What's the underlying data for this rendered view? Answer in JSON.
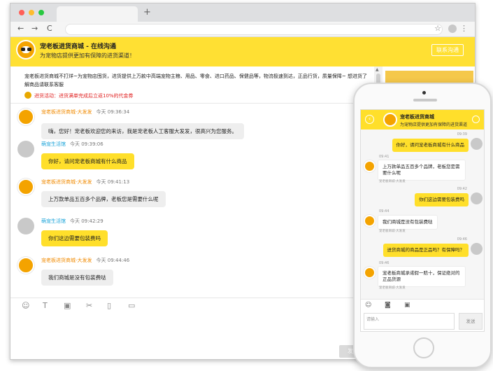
{
  "browser": {
    "dot_colors": [
      "#ff5f57",
      "#febc2e",
      "#28c840"
    ],
    "new_tab_label": "+",
    "back_icon": "←",
    "forward_icon": "→",
    "reload_icon": "C",
    "star_icon": "☆",
    "menu_icon": "⋮"
  },
  "header": {
    "title": "宠老板进货商城 - 在线沟通",
    "subtitle": "为宠物店提供更加有保障的进货渠道！",
    "button_label": "联系沟通"
  },
  "notice": {
    "text": "宠老板进货商城不打烊~为宠物店囤货，进货提供上万款中高端宠物主粮、用品、零食、进口药品、保健品等，物流极速到达，正品行货，质量保障~ 想进货了解商品请联系客服",
    "promo": "进货活动：进货满单完成后立返10%的代金券"
  },
  "messages": [
    {
      "sender": "宠老板进货商城-大发发",
      "time": "今天 09:36:34",
      "text": "嗨，您好！宠老板欢迎您的来访，我是宠老板人工客服大发发，很高兴为您服务。",
      "role": "shop"
    },
    {
      "sender": "萌宠生活馆",
      "time": "今天 09:39:06",
      "text": "你好，请问宠老板商城有什么商品",
      "role": "user"
    },
    {
      "sender": "宠老板进货商城-大发发",
      "time": "今天 09:41:13",
      "text": "上万款单品五百多个品牌，老板您是需要什么呢",
      "role": "shop"
    },
    {
      "sender": "萌宠生活馆",
      "time": "今天 09:42:29",
      "text": "你们这边需要包装费吗",
      "role": "user"
    },
    {
      "sender": "宠老板进货商城-大发发",
      "time": "今天 09:44:46",
      "text": "我们商城是没有包装费哒",
      "role": "shop"
    }
  ],
  "toolbar": {
    "emoji_icon": "☺",
    "text_icon": "T",
    "image_icon": "▣",
    "cut_icon": "✂",
    "video_icon": "▯",
    "folder_icon": "▭",
    "send_label": "发送"
  },
  "phone": {
    "title": "宠老板进货商城",
    "subtitle": "为宠物店提供更加有保障的进货渠道",
    "back_icon": "‹",
    "messages": [
      {
        "time": "09:39",
        "text": "你好，请问宠老板商城有什么商品",
        "role": "user"
      },
      {
        "time": "09:41",
        "text": "上万款单品五百多个品牌，老板您是需要什么呢",
        "role": "shop",
        "from": "宠老板商城-大发发"
      },
      {
        "time": "09:42",
        "text": "你们这边需要包装费吗",
        "role": "user"
      },
      {
        "time": "09:44",
        "text": "我们商城是没有包装费哒",
        "role": "shop",
        "from": "宠老板商城-大发发"
      },
      {
        "time": "09:46",
        "text": "进货商城的商品是正品吗？有保障吗？",
        "role": "user"
      },
      {
        "time": "09:46",
        "text": "宠老板商城承诺假一赔十，保证绝对的正品货源",
        "role": "shop",
        "from": "宠老板商城-大发发"
      }
    ],
    "input_placeholder": "请输入",
    "send_label": "发送",
    "emoji_icon": "☺",
    "camera_icon": "◙",
    "image_icon": "▣"
  }
}
